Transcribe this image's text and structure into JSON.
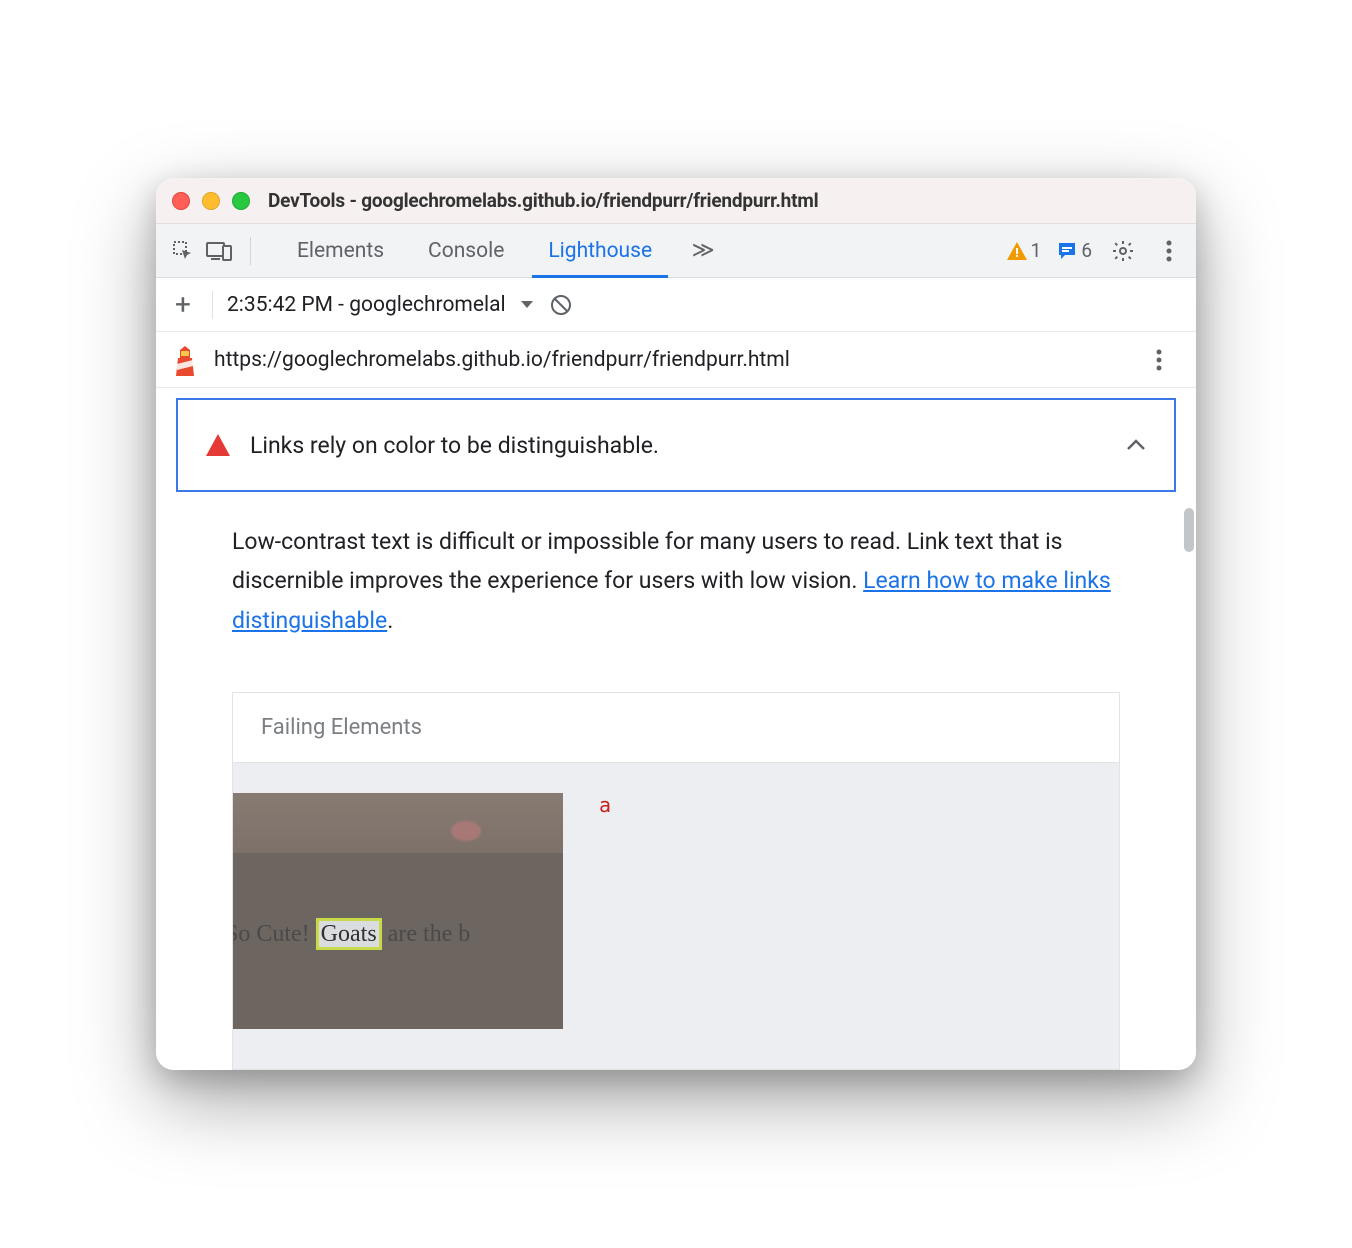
{
  "window": {
    "title": "DevTools - googlechromelabs.github.io/friendpurr/friendpurr.html"
  },
  "toolbar": {
    "tabs": [
      "Elements",
      "Console",
      "Lighthouse"
    ],
    "active_tab_index": 2,
    "overflow_glyph": "≫",
    "warning_count": "1",
    "message_count": "6"
  },
  "subbar": {
    "run_label": "2:35:42 PM - googlechromelal"
  },
  "urlbar": {
    "url": "https://googlechromelabs.github.io/friendpurr/friendpurr.html"
  },
  "audit": {
    "title": "Links rely on color to be distinguishable.",
    "description_pre": "Low-contrast text is difficult or impossible for many users to read. Link text that is discernible improves the experience for users with low vision. ",
    "learn_link": "Learn how to make links distinguishable",
    "description_post": "."
  },
  "failing": {
    "heading": "Failing Elements",
    "element_tag": "a",
    "thumb_text_pre": "So Cute! ",
    "thumb_highlight": "Goats",
    "thumb_text_post": " are the b"
  }
}
